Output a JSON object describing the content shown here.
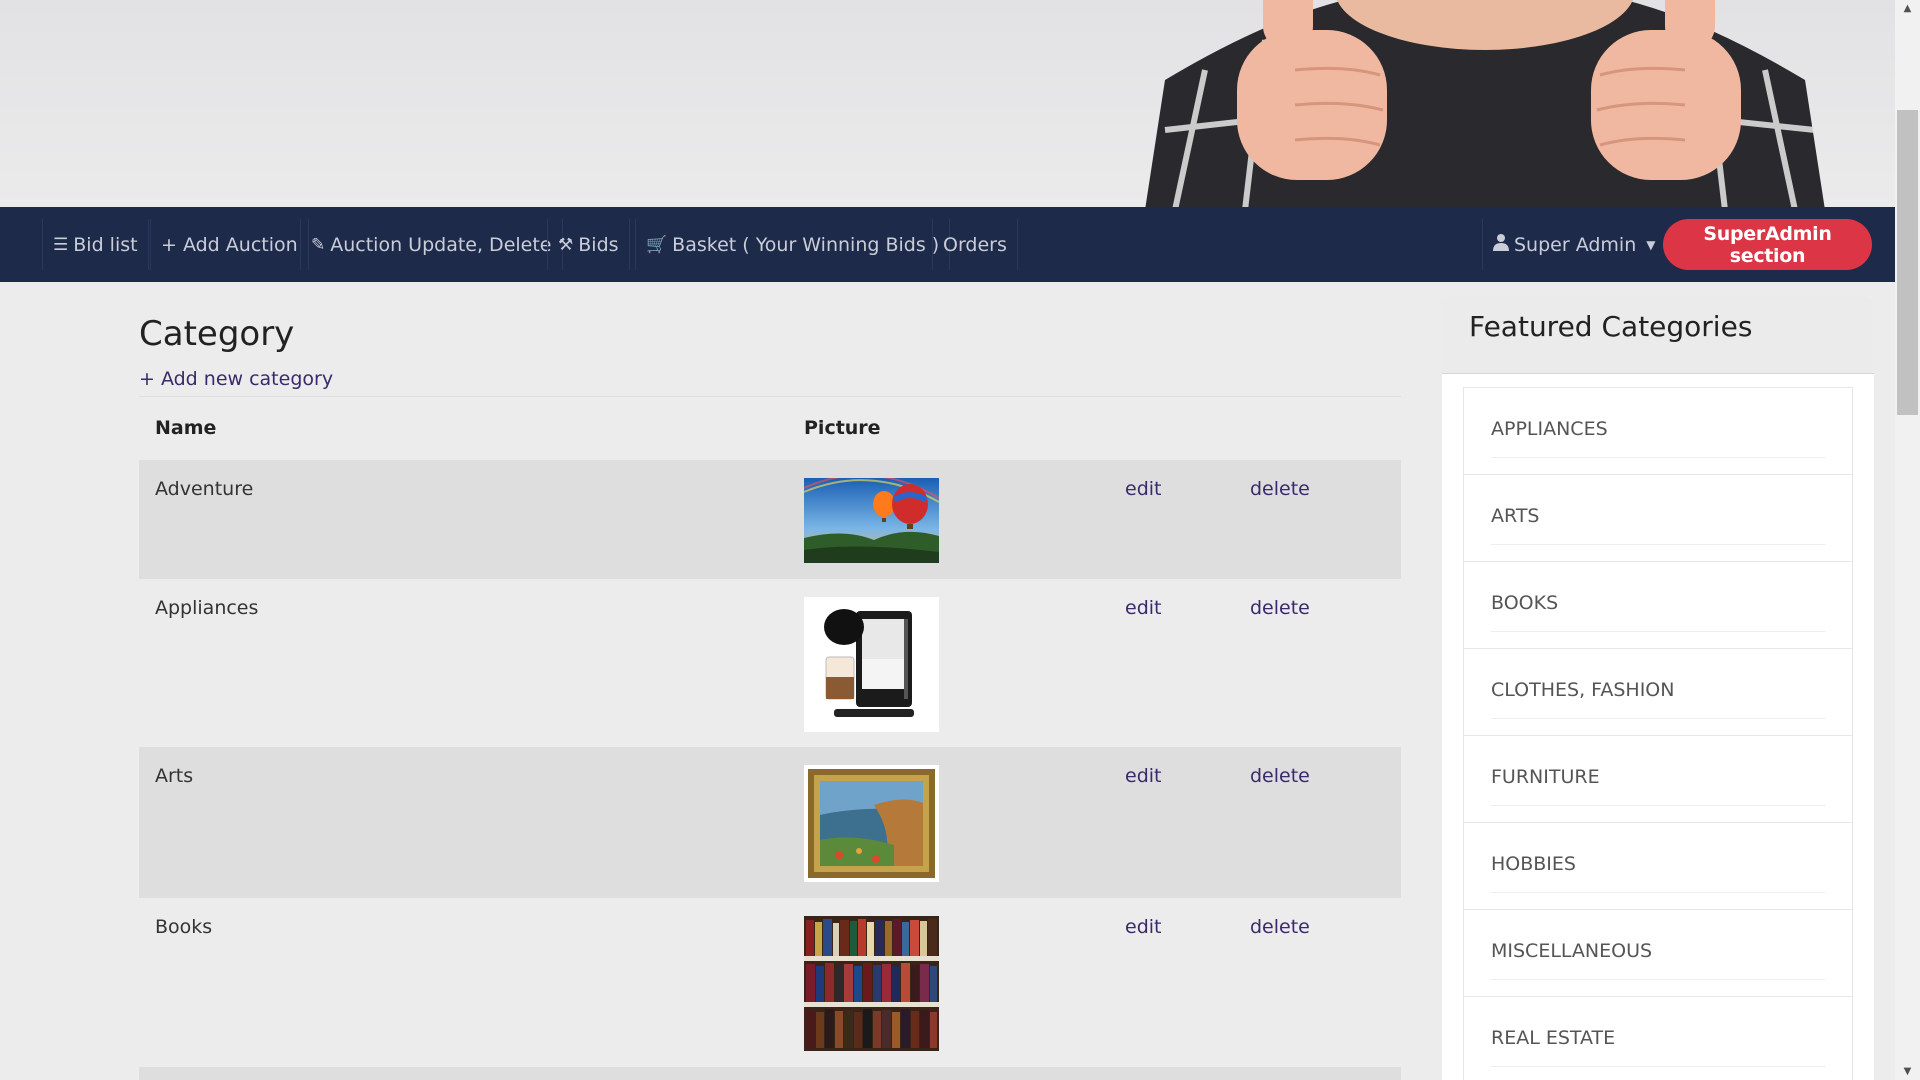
{
  "nav": {
    "items": [
      {
        "label": "Bid list",
        "icon": "list-icon",
        "glyph": "☰"
      },
      {
        "label": "+ Add Auction",
        "icon": "",
        "glyph": ""
      },
      {
        "label": "Auction Update, Delete",
        "icon": "pencil-icon",
        "glyph": "✎"
      },
      {
        "label": "Bids",
        "icon": "gavel-icon",
        "glyph": "⚒"
      },
      {
        "label": "Basket ( Your Winning Bids )",
        "icon": "cart-icon",
        "glyph": "🛒"
      },
      {
        "label": "Orders",
        "icon": "",
        "glyph": ""
      }
    ],
    "user_label": "Super Admin",
    "superadmin_label": "SuperAdmin section"
  },
  "page": {
    "title": "Category",
    "add_link": "+ Add new category"
  },
  "table": {
    "headers": {
      "name": "Name",
      "picture": "Picture"
    },
    "rows": [
      {
        "name": "Adventure",
        "picture": "hot-air-balloons",
        "edit": "edit",
        "delete": "delete"
      },
      {
        "name": "Appliances",
        "picture": "coffee-machine",
        "edit": "edit",
        "delete": "delete"
      },
      {
        "name": "Arts",
        "picture": "framed-painting",
        "edit": "edit",
        "delete": "delete"
      },
      {
        "name": "Books",
        "picture": "bookshelf",
        "edit": "edit",
        "delete": "delete"
      }
    ]
  },
  "featured": {
    "title": "Featured Categories",
    "items": [
      "APPLIANCES",
      "ARTS",
      "BOOKS",
      "CLOTHES, FASHION",
      "FURNITURE",
      "HOBBIES",
      "MISCELLANEOUS",
      "REAL ESTATE"
    ]
  },
  "colors": {
    "navbar": "#1e2a4a",
    "superadmin_button": "#dc3545",
    "link": "#3a2a6b"
  }
}
